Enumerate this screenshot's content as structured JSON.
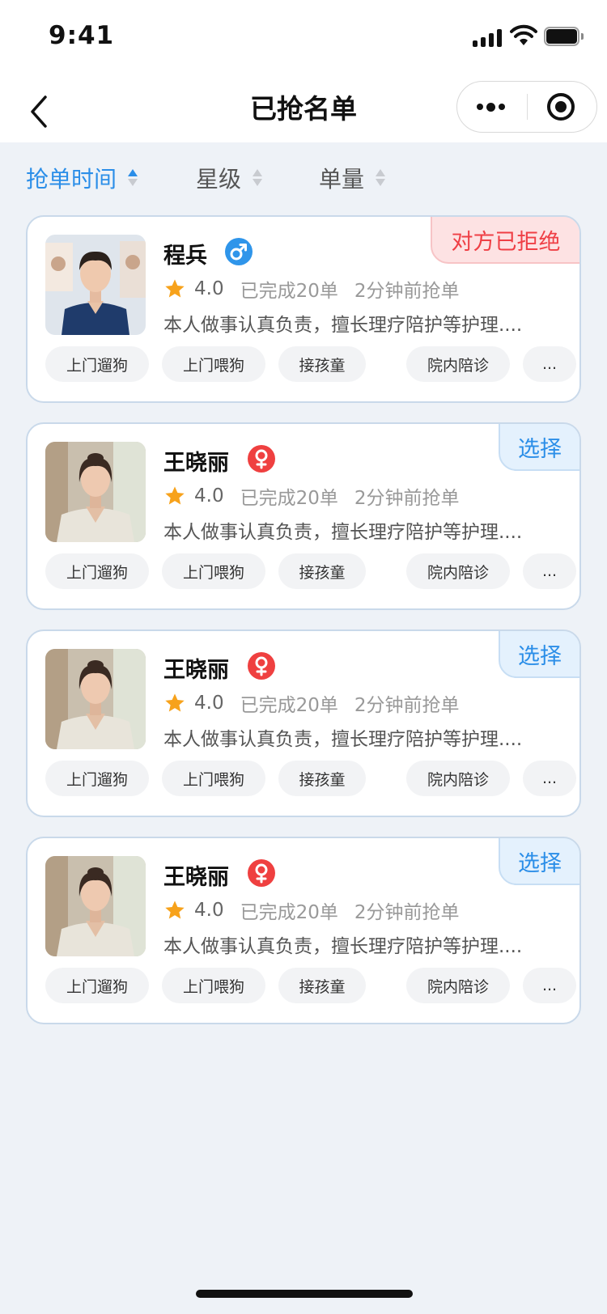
{
  "status_bar": {
    "time": "9:41"
  },
  "header": {
    "title": "已抢名单"
  },
  "sort_bar": {
    "items": [
      {
        "label": "抢单时间",
        "active": true
      },
      {
        "label": "星级",
        "active": false
      },
      {
        "label": "单量",
        "active": false
      }
    ]
  },
  "cards": [
    {
      "name": "程兵",
      "gender": "male",
      "rating": "4.0",
      "completed": "已完成20单",
      "grabbed": "2分钟前抢单",
      "description": "本人做事认真负责，擅长理疗陪护等护理....",
      "tags": [
        "上门遛狗",
        "上门喂狗",
        "接孩童",
        "院内陪诊",
        "..."
      ],
      "status": "对方已拒绝",
      "status_type": "rejected"
    },
    {
      "name": "王晓丽",
      "gender": "female",
      "rating": "4.0",
      "completed": "已完成20单",
      "grabbed": "2分钟前抢单",
      "description": "本人做事认真负责，擅长理疗陪护等护理....",
      "tags": [
        "上门遛狗",
        "上门喂狗",
        "接孩童",
        "院内陪诊",
        "..."
      ],
      "status": "选择",
      "status_type": "select"
    },
    {
      "name": "王晓丽",
      "gender": "female",
      "rating": "4.0",
      "completed": "已完成20单",
      "grabbed": "2分钟前抢单",
      "description": "本人做事认真负责，擅长理疗陪护等护理....",
      "tags": [
        "上门遛狗",
        "上门喂狗",
        "接孩童",
        "院内陪诊",
        "..."
      ],
      "status": "选择",
      "status_type": "select"
    },
    {
      "name": "王晓丽",
      "gender": "female",
      "rating": "4.0",
      "completed": "已完成20单",
      "grabbed": "2分钟前抢单",
      "description": "本人做事认真负责，擅长理疗陪护等护理....",
      "tags": [
        "上门遛狗",
        "上门喂狗",
        "接孩童",
        "院内陪诊",
        "..."
      ],
      "status": "选择",
      "status_type": "select"
    }
  ],
  "colors": {
    "accent": "#2b8ee8",
    "rejected": "#ef3f45",
    "male": "#2f95ea",
    "female": "#ef4040",
    "star": "#f7a21b",
    "background": "#eef2f7"
  },
  "icons": {
    "back": "chevron-left-icon",
    "more": "more-dots-icon",
    "close": "target-circle-icon",
    "star": "star-icon",
    "male": "male-icon",
    "female": "female-icon"
  }
}
